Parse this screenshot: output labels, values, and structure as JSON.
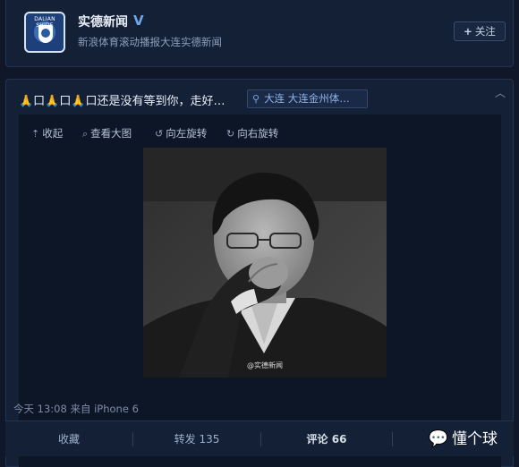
{
  "account": {
    "name": "实德新闻",
    "verified_mark": "V",
    "subtitle": "新浪体育滚动播报大连实德新闻",
    "avatar_text": "DALIAN SHIDE",
    "follow_label": "关注"
  },
  "post": {
    "text": "🙏口🙏口🙏口还是没有等到你，走好…",
    "location": "大连 大连金州体…",
    "toolbar": {
      "collapse": "收起",
      "view_large": "查看大图",
      "rotate_left": "向左旋转",
      "rotate_right": "向右旋转"
    },
    "photo_watermark": "@实德新闻",
    "meta": "今天 13:08 来自 iPhone 6"
  },
  "actions": {
    "favorite": "收藏",
    "repost": "转发 135",
    "comment": "评论 66"
  },
  "brand": {
    "icon": "wechat-icon",
    "label": "懂个球"
  }
}
